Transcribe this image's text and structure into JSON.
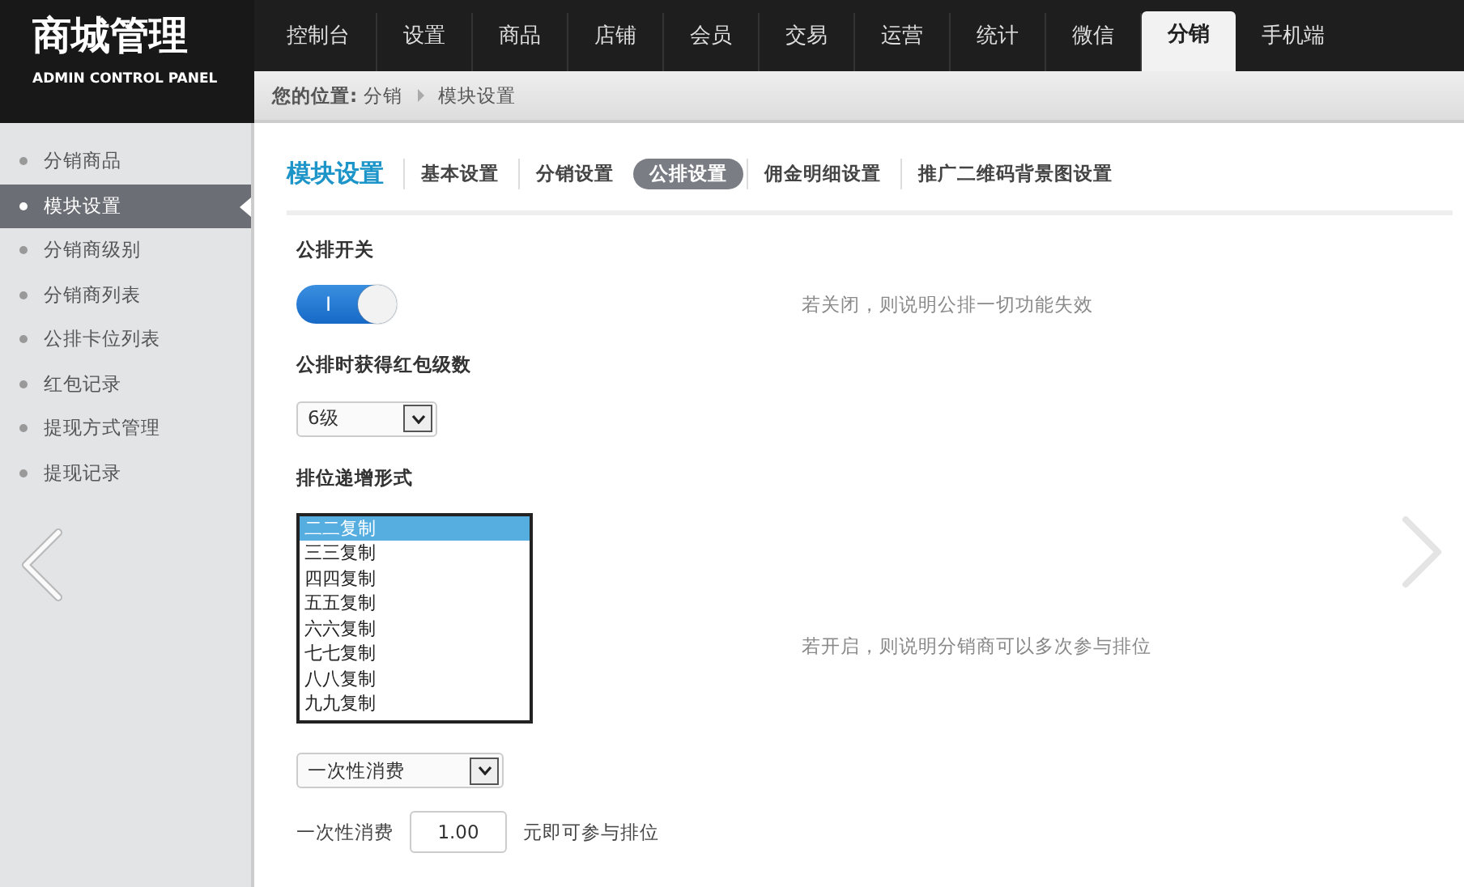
{
  "logo": {
    "title": "商城管理",
    "subtitle": "ADMIN CONTROL PANEL"
  },
  "nav": [
    {
      "label": "控制台",
      "selected": false
    },
    {
      "label": "设置",
      "selected": false
    },
    {
      "label": "商品",
      "selected": false
    },
    {
      "label": "店铺",
      "selected": false
    },
    {
      "label": "会员",
      "selected": false
    },
    {
      "label": "交易",
      "selected": false
    },
    {
      "label": "运营",
      "selected": false
    },
    {
      "label": "统计",
      "selected": false
    },
    {
      "label": "微信",
      "selected": false
    },
    {
      "label": "分销",
      "selected": true
    },
    {
      "label": "手机端",
      "selected": false
    }
  ],
  "breadcrumb": {
    "prefix": "您的位置:",
    "items": [
      "分销",
      "模块设置"
    ]
  },
  "sidebar": {
    "items": [
      {
        "label": "分销商品",
        "selected": false
      },
      {
        "label": "模块设置",
        "selected": true
      },
      {
        "label": "分销商级别",
        "selected": false
      },
      {
        "label": "分销商列表",
        "selected": false
      },
      {
        "label": "公排卡位列表",
        "selected": false
      },
      {
        "label": "红包记录",
        "selected": false
      },
      {
        "label": "提现方式管理",
        "selected": false
      },
      {
        "label": "提现记录",
        "selected": false
      }
    ]
  },
  "page_title": "模块设置",
  "tabs": [
    {
      "label": "基本设置",
      "selected": false
    },
    {
      "label": "分销设置",
      "selected": false
    },
    {
      "label": "公排设置",
      "selected": true
    },
    {
      "label": "佣金明细设置",
      "selected": false
    },
    {
      "label": "推广二维码背景图设置",
      "selected": false
    }
  ],
  "form": [
    {
      "kind": "toggle",
      "label": "公排开关",
      "on": true,
      "on_mark": "I",
      "hint": "若关闭，则说明公排一切功能失效"
    },
    {
      "kind": "select",
      "label": "公排时获得红包级数",
      "value": "6级"
    },
    {
      "kind": "listbox",
      "label": "排位递增形式",
      "options": [
        {
          "label": "二二复制",
          "selected": true
        },
        {
          "label": "三三复制",
          "selected": false
        },
        {
          "label": "四四复制",
          "selected": false
        },
        {
          "label": "五五复制",
          "selected": false
        },
        {
          "label": "六六复制",
          "selected": false
        },
        {
          "label": "七七复制",
          "selected": false
        },
        {
          "label": "八八复制",
          "selected": false
        },
        {
          "label": "九九复制",
          "selected": false
        }
      ],
      "hint": "若开启，则说明分销商可以多次参与排位"
    },
    {
      "kind": "select",
      "value": "一次性消费"
    },
    {
      "kind": "amount",
      "prefix": "一次性消费",
      "value": "1.00",
      "suffix": "元即可参与排位"
    }
  ]
}
